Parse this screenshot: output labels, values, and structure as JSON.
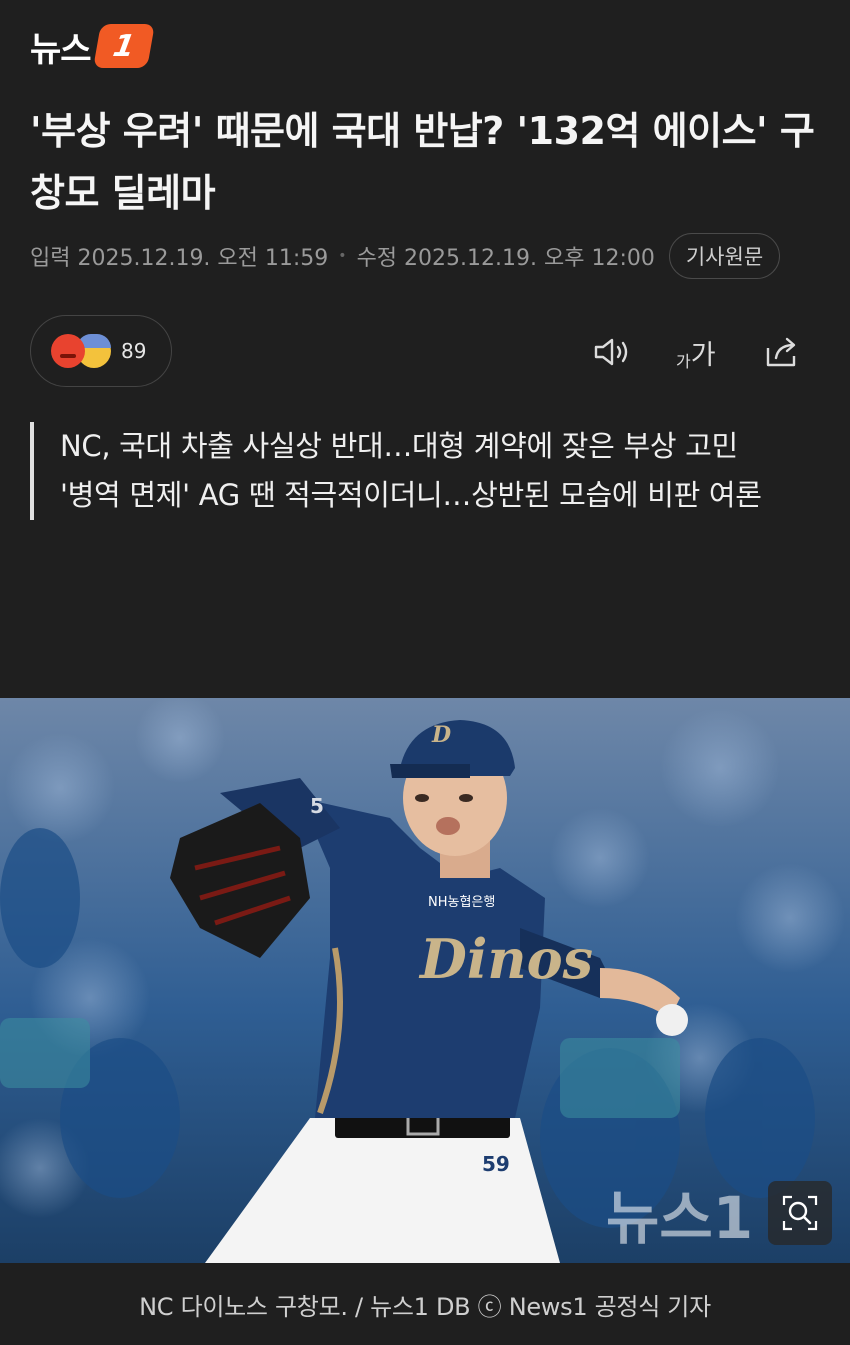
{
  "brand": {
    "logo_text": "뉴스",
    "logo_badge": "1",
    "accent_color": "#f15a24"
  },
  "article": {
    "title": "'부상 우려' 때문에 국대 반납? '132억 에이스' 구창모 딜레마",
    "published": "입력 2025.12.19. 오전 11:59",
    "modified": "수정 2025.12.19. 오후 12:00",
    "source_button": "기사원문"
  },
  "reactions": {
    "icons": [
      "angry-emoji-icon",
      "sad-emoji-icon"
    ],
    "count": "89"
  },
  "toolbar": {
    "icons": [
      "speaker-icon",
      "font-size-icon",
      "share-icon"
    ],
    "font_small": "가",
    "font_big": "가"
  },
  "summary": {
    "lines": [
      "NC, 국대 차출 사실상 반대…대형 계약에 잦은 부상 고민",
      "'병역 면제' AG 땐 적극적이더니…상반된 모습에 비판 여론"
    ]
  },
  "photo": {
    "watermark": "뉴스1",
    "jersey_sponsor": "NH농협은행",
    "jersey_text": "Dinos",
    "jersey_number": "59",
    "zoom_icon": "magnifier-icon"
  },
  "caption": {
    "text": "NC 다이노스 구창모. / 뉴스1 DB ⓒ News1 공정식 기자"
  }
}
